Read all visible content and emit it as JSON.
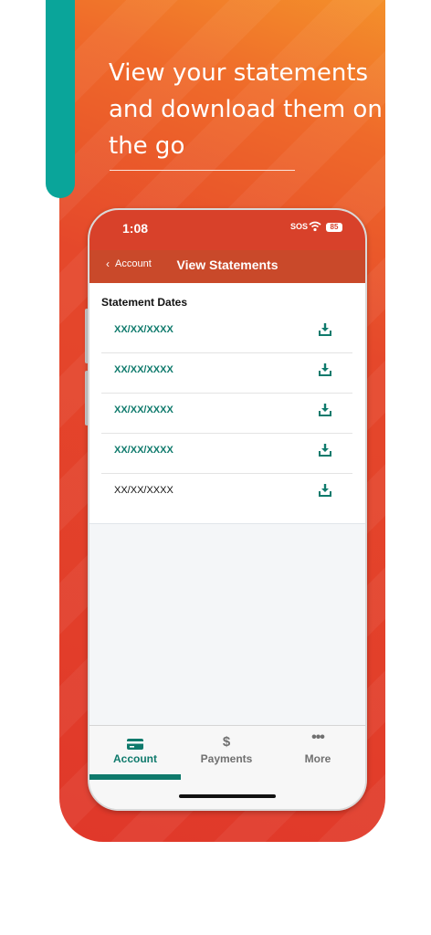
{
  "promo": {
    "headline": "View your statements and download them on the go",
    "colors": {
      "accent_teal": "#0aa59a",
      "gradient_start": "#f59a2b",
      "gradient_end": "#e0382a"
    }
  },
  "status_bar": {
    "time": "1:08",
    "carrier": "SOS",
    "battery": "85",
    "icons": [
      "wifi-icon",
      "battery-icon"
    ]
  },
  "nav": {
    "back_label": "Account",
    "back_icon": "chevron-left-icon",
    "title": "View Statements"
  },
  "statements": {
    "section_title": "Statement Dates",
    "download_icon": "download-icon",
    "rows": [
      {
        "date": "XX/XX/XXXX",
        "style": "link"
      },
      {
        "date": "XX/XX/XXXX",
        "style": "link"
      },
      {
        "date": "XX/XX/XXXX",
        "style": "link"
      },
      {
        "date": "XX/XX/XXXX",
        "style": "link"
      },
      {
        "date": "XX/XX/XXXX",
        "style": "plain"
      }
    ]
  },
  "tabs": [
    {
      "label": "Account",
      "icon": "card-icon",
      "active": true
    },
    {
      "label": "Payments",
      "icon": "dollar-icon",
      "active": false
    },
    {
      "label": "More",
      "icon": "more-icon",
      "active": false
    }
  ],
  "colors": {
    "brand_green": "#0f7a6c",
    "header_red": "#c9492a"
  }
}
